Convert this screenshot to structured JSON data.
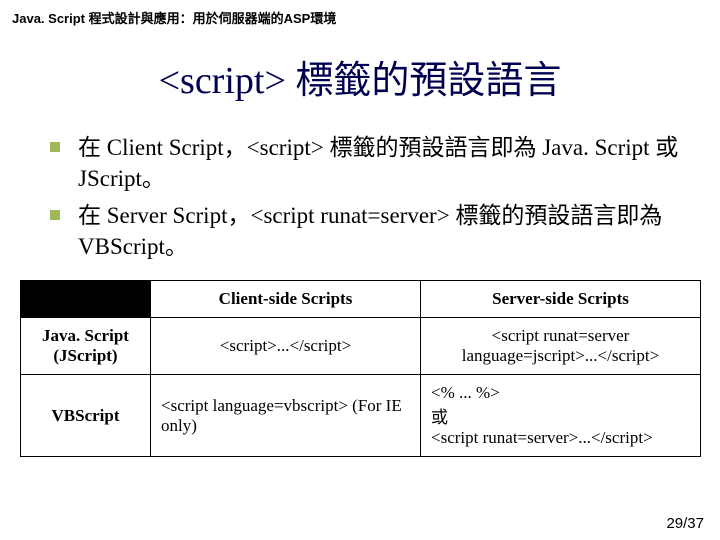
{
  "header": "Java. Script 程式設計與應用：用於伺服器端的ASP環境",
  "title": "<script> 標籤的預設語言",
  "bullets": [
    "在 Client Script，<script> 標籤的預設語言即為 Java. Script 或 JScript。",
    "在 Server Script，<script runat=server> 標籤的預設語言即為 VBScript。"
  ],
  "table": {
    "headers": [
      "",
      "Client-side Scripts",
      "Server-side Scripts"
    ],
    "rows": [
      {
        "label": "Java. Script (JScript)",
        "client": "<script>...</script>",
        "server": "<script runat=server language=jscript>...</script>"
      },
      {
        "label": "VBScript",
        "client": "<script language=vbscript> (For IE only)",
        "server": "<% ... %>\n或\n<script runat=server>...</script>"
      }
    ]
  },
  "footer": "29/37"
}
